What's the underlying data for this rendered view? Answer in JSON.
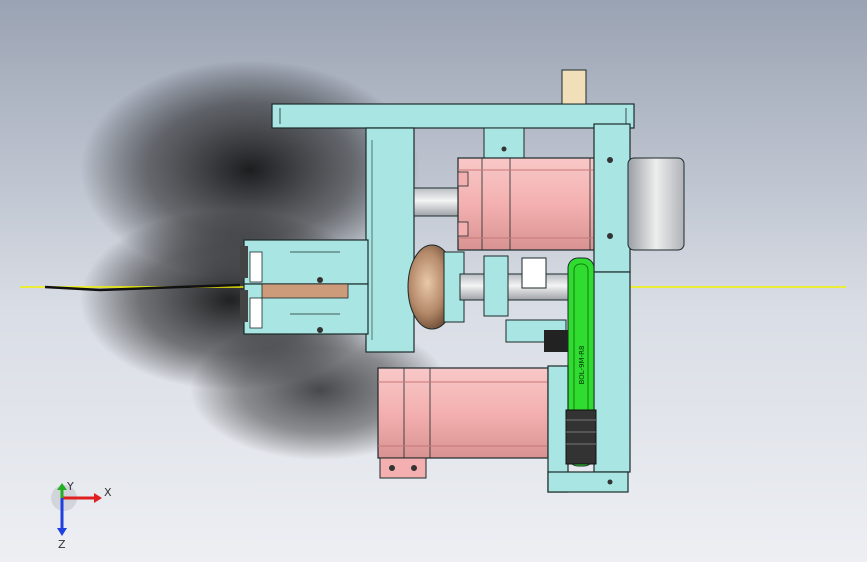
{
  "view": {
    "background_top": "#9aa3b3",
    "background_bottom": "#edeff3"
  },
  "colors": {
    "frame": "#a9e6e3",
    "motor": "#f4b0b0",
    "motor_dark": "#c97878",
    "steel": "#d8d8d8",
    "bronze": "#b58a6a",
    "belt": "#2fdc2f",
    "edge": "#1c2a2a",
    "wire": "#f2f200"
  },
  "belt_label": "BOL-9M-R8",
  "triad": {
    "x_label": "X",
    "y_label": "Y",
    "z_label": "Z"
  }
}
